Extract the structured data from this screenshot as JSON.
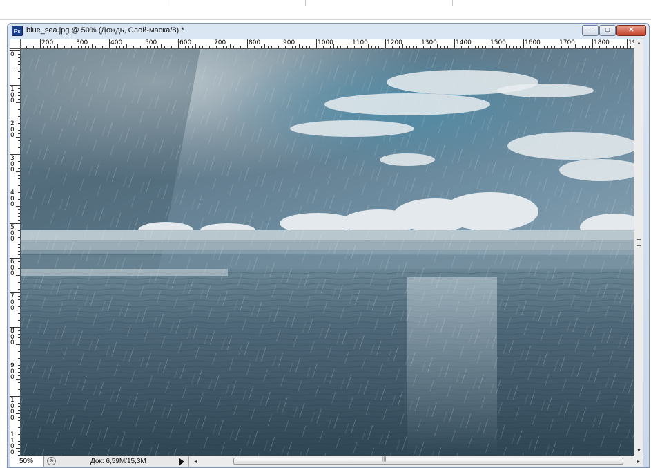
{
  "window": {
    "app_icon_label": "Ps",
    "title": "blue_sea.jpg @ 50% (Дождь, Слой-маска/8) *",
    "buttons": {
      "minimize": "–",
      "restore": "□",
      "close": "✕"
    }
  },
  "ruler": {
    "horizontal_labels": [
      "200",
      "300",
      "400",
      "500",
      "600",
      "700",
      "800",
      "900",
      "1000",
      "1100",
      "1200",
      "1300",
      "1400",
      "1500",
      "1600",
      "1700",
      "1800",
      "19"
    ],
    "vertical_labels": [
      "0",
      "100",
      "200",
      "300",
      "400",
      "500",
      "600",
      "700",
      "800",
      "900",
      "1000",
      "1100"
    ]
  },
  "status": {
    "zoom": "50%",
    "doc_info": "Док: 6,59M/15,3M"
  },
  "colors": {
    "window_frame": "#c9d8ea",
    "close_button": "#c4412a",
    "sky_top": "#6f8797",
    "sea": "#3d5563"
  },
  "icons": [
    "photoshop-app-icon",
    "minimize-icon",
    "restore-icon",
    "close-icon",
    "status-menu-arrow-icon",
    "zoom-navigator-icon"
  ]
}
